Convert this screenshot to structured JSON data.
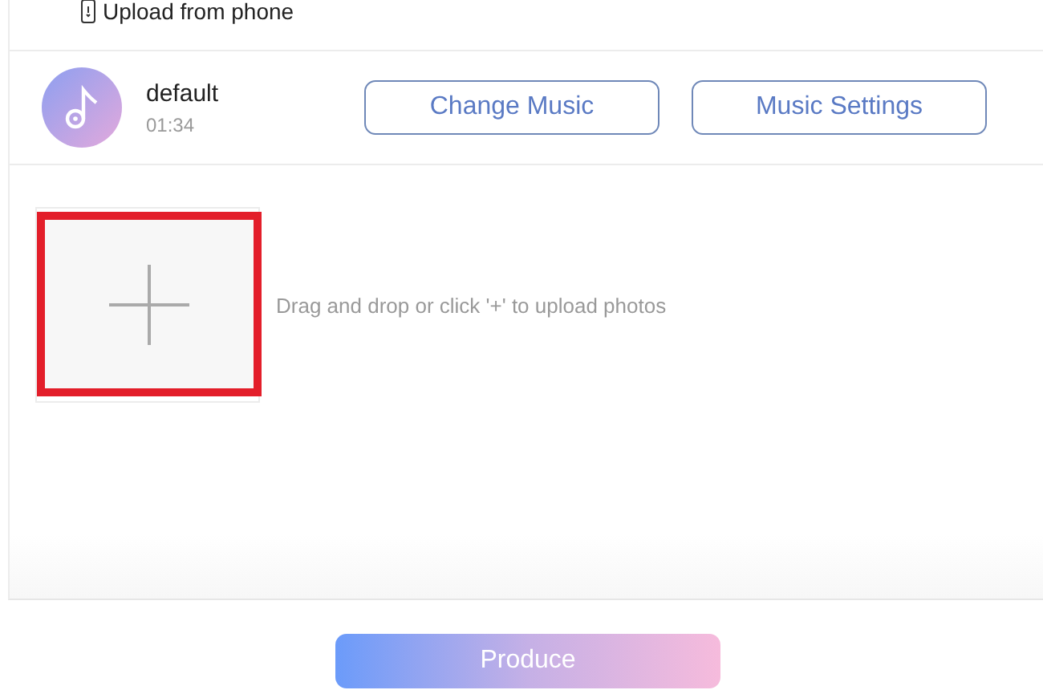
{
  "upload_link": {
    "label": "Upload from phone"
  },
  "music": {
    "title": "default",
    "duration": "01:34",
    "buttons": [
      "Change Music",
      "Music Settings"
    ]
  },
  "uploader": {
    "hint": "Drag and drop or click '+' to upload photos",
    "highlighted": true
  },
  "produce_button": {
    "label": "Produce"
  }
}
